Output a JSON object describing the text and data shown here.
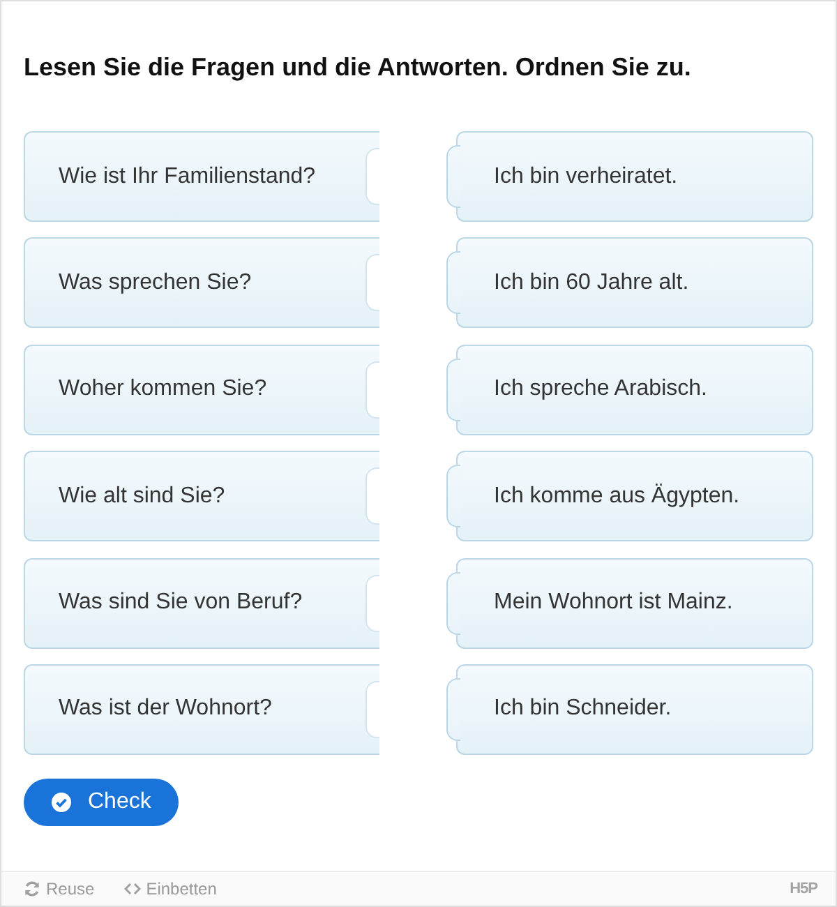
{
  "title": "Lesen Sie die Fragen und die Antworten. Ordnen Sie zu.",
  "questions": [
    "Wie ist Ihr Familienstand?",
    "Was sprechen Sie?",
    "Woher kommen Sie?",
    "Wie alt sind Sie?",
    "Was sind Sie von Beruf?",
    "Was ist der Wohnort?"
  ],
  "answers": [
    "Ich bin verheiratet.",
    "Ich bin 60 Jahre alt.",
    "Ich spreche Arabisch.",
    "Ich komme aus Ägypten.",
    "Mein Wohnort ist Mainz.",
    "Ich bin Schneider."
  ],
  "check_button": {
    "label": "Check"
  },
  "footer": {
    "links": [
      {
        "kind": "reuse",
        "label": "Reuse"
      },
      {
        "kind": "embed",
        "label": "Einbetten"
      }
    ],
    "logo": "H5P"
  }
}
